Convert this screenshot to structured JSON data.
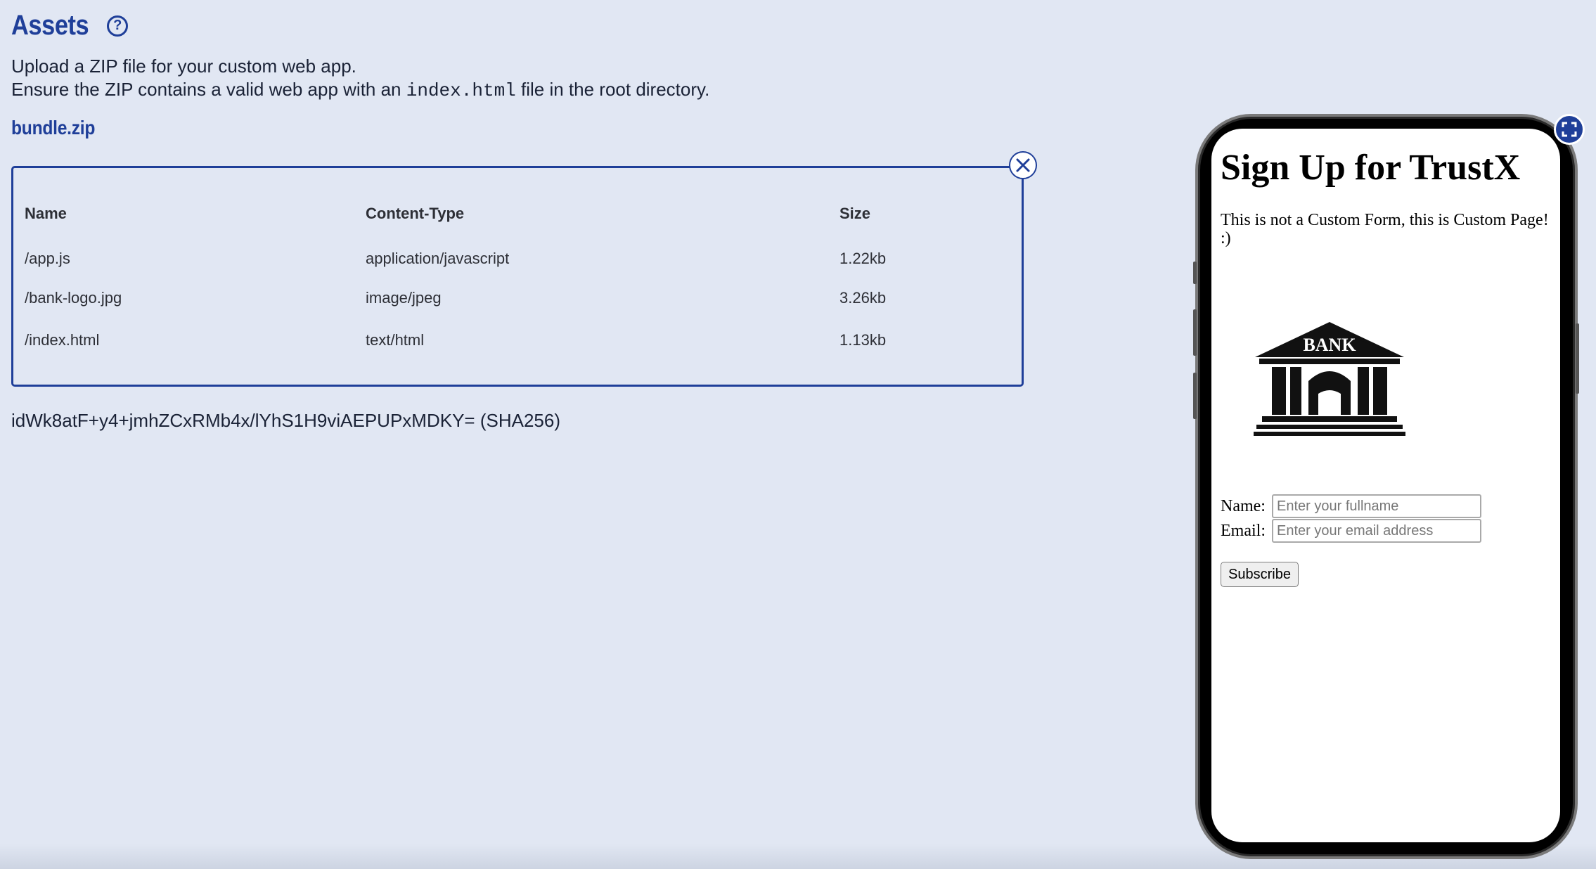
{
  "header": {
    "title": "Assets",
    "help_icon": "question-circle-icon"
  },
  "description": {
    "line1": "Upload a ZIP file for your custom web app.",
    "line2_before": "Ensure the ZIP contains a valid web app with an ",
    "line2_code": "index.html",
    "line2_after": " file in the root directory."
  },
  "file": {
    "name": "bundle.zip"
  },
  "assets_table": {
    "columns": [
      "Name",
      "Content-Type",
      "Size"
    ],
    "rows": [
      {
        "name": "/app.js",
        "content_type": "application/javascript",
        "size": "1.22kb"
      },
      {
        "name": "/bank-logo.jpg",
        "content_type": "image/jpeg",
        "size": "3.26kb"
      },
      {
        "name": "/index.html",
        "content_type": "text/html",
        "size": "1.13kb"
      }
    ]
  },
  "hash": {
    "text": "idWk8atF+y4+jmhZCxRMb4x/lYhS1H9viAEPUPxMDKY= (SHA256)"
  },
  "preview": {
    "fullscreen_icon": "expand-icon",
    "heading": "Sign Up for TrustX",
    "paragraph": "This is not a Custom Form, this is Custom Page! :)",
    "logo_text": "BANK",
    "name_label": "Name:",
    "name_placeholder": "Enter your fullname",
    "email_label": "Email:",
    "email_placeholder": "Enter your email address",
    "subscribe_label": "Subscribe"
  },
  "colors": {
    "background": "#e1e7f3",
    "accent": "#1f3f99",
    "text": "#1a2236"
  }
}
